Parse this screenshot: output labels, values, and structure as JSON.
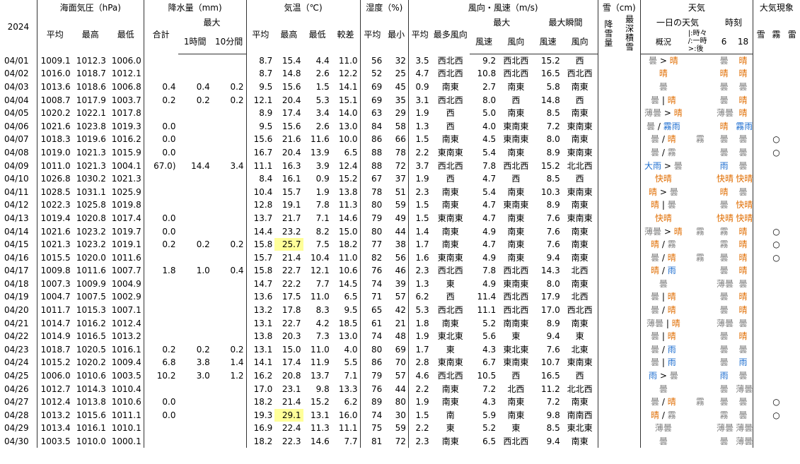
{
  "header": {
    "year": "2024",
    "pressure_group": "海面気圧（hPa)",
    "precip_group": "降水量（mm)",
    "temp_group": "気温（℃)",
    "humidity_group": "湿度（%)",
    "wind_group": "風向・風速（m/s)",
    "snow_group": "雪（cm)",
    "weather_group": "天気",
    "phenomena_group": "大気現象",
    "max": "最大",
    "max_wind": "最大",
    "max_gust": "最大瞬間",
    "day_weather": "一日の天気",
    "times": "時刻",
    "sub": {
      "p_avg": "平均",
      "p_max": "最高",
      "p_min": "最低",
      "r_total": "合計",
      "r_1h": "1時間",
      "r_10m": "10分間",
      "t_avg": "平均",
      "t_max": "最高",
      "t_min": "最低",
      "t_range": "較差",
      "h_avg": "平均",
      "h_min": "最小",
      "w_avg": "平均",
      "w_mostdir": "最多風向",
      "w_spd": "風速",
      "w_dir": "風向",
      "g_spd": "風速",
      "g_dir": "風向",
      "snowfall": "降雪量",
      "snowdepth": "最深積雪",
      "gaikyo": "概況",
      "legend": "|:時々\n/:一時\n>:後",
      "tomonau": "伴う現象",
      "t6": "6",
      "t18": "18",
      "ph_snow": "雪",
      "ph_fog": "霧",
      "ph_thunder": "雷"
    }
  },
  "rows": [
    {
      "date": "04/01",
      "pa": "1009.1",
      "px": "1012.3",
      "pn": "1006.0",
      "rt": "",
      "r1": "",
      "r10": "",
      "ta": "8.7",
      "tx": "15.4",
      "tn": "4.4",
      "tr": "11.0",
      "ha": "56",
      "hn": "32",
      "wa": "3.5",
      "wm": "西北西",
      "ws": "9.2",
      "wd": "西北西",
      "gs": "15.2",
      "gd": "西",
      "w": "曇 > 晴",
      "wp": "",
      "w6": "曇",
      "w18": "晴",
      "fog": ""
    },
    {
      "date": "04/02",
      "pa": "1016.0",
      "px": "1018.7",
      "pn": "1012.1",
      "rt": "",
      "r1": "",
      "r10": "",
      "ta": "8.7",
      "tx": "14.8",
      "tn": "2.6",
      "tr": "12.2",
      "ha": "52",
      "hn": "25",
      "wa": "4.7",
      "wm": "西北西",
      "ws": "10.8",
      "wd": "西北西",
      "gs": "16.5",
      "gd": "西北西",
      "w": "晴",
      "wp": "",
      "w6": "晴",
      "w18": "晴",
      "fog": ""
    },
    {
      "date": "04/03",
      "pa": "1013.6",
      "px": "1018.6",
      "pn": "1006.8",
      "rt": "0.4",
      "r1": "0.4",
      "r10": "0.2",
      "ta": "9.5",
      "tx": "15.6",
      "tn": "1.5",
      "tr": "14.1",
      "ha": "69",
      "hn": "45",
      "wa": "0.9",
      "wm": "南東",
      "ws": "2.7",
      "wd": "南東",
      "gs": "5.8",
      "gd": "南東",
      "w": "曇",
      "wp": "",
      "w6": "曇",
      "w18": "曇",
      "fog": ""
    },
    {
      "date": "04/04",
      "pa": "1008.7",
      "px": "1017.9",
      "pn": "1003.7",
      "rt": "0.2",
      "r1": "0.2",
      "r10": "0.2",
      "ta": "12.1",
      "tx": "20.4",
      "tn": "5.3",
      "tr": "15.1",
      "ha": "69",
      "hn": "35",
      "wa": "3.1",
      "wm": "西北西",
      "ws": "8.0",
      "wd": "西",
      "gs": "14.8",
      "gd": "西",
      "w": "曇 | 晴",
      "wp": "",
      "w6": "曇",
      "w18": "晴",
      "fog": ""
    },
    {
      "date": "04/05",
      "pa": "1020.2",
      "px": "1022.1",
      "pn": "1017.8",
      "rt": "",
      "r1": "",
      "r10": "",
      "ta": "8.9",
      "tx": "17.4",
      "tn": "3.4",
      "tr": "14.0",
      "ha": "63",
      "hn": "29",
      "wa": "1.9",
      "wm": "西",
      "ws": "5.0",
      "wd": "南東",
      "gs": "8.5",
      "gd": "南東",
      "w": "薄曇 > 晴",
      "wp": "",
      "w6": "薄曇",
      "w18": "晴",
      "fog": ""
    },
    {
      "date": "04/06",
      "pa": "1021.6",
      "px": "1023.8",
      "pn": "1019.3",
      "rt": "0.0",
      "r1": "",
      "r10": "",
      "ta": "9.5",
      "tx": "15.6",
      "tn": "2.6",
      "tr": "13.0",
      "ha": "84",
      "hn": "58",
      "wa": "1.3",
      "wm": "西",
      "ws": "4.0",
      "wd": "東南東",
      "gs": "7.2",
      "gd": "東南東",
      "w": "曇 / 霧雨",
      "wp": "",
      "w6": "晴",
      "w18": "霧雨",
      "fog": ""
    },
    {
      "date": "04/07",
      "pa": "1018.3",
      "px": "1019.6",
      "pn": "1016.2",
      "rt": "0.0",
      "r1": "",
      "r10": "",
      "ta": "15.6",
      "tx": "21.6",
      "tn": "11.6",
      "tr": "10.0",
      "ha": "86",
      "hn": "66",
      "wa": "1.5",
      "wm": "南東",
      "ws": "4.5",
      "wd": "東南東",
      "gs": "8.0",
      "gd": "南東",
      "w": "曇 / 晴",
      "wp": "霧",
      "w6": "曇",
      "w18": "曇",
      "fog": "○"
    },
    {
      "date": "04/08",
      "pa": "1019.0",
      "px": "1021.3",
      "pn": "1015.9",
      "rt": "0.0",
      "r1": "",
      "r10": "",
      "ta": "16.7",
      "tx": "20.4",
      "tn": "13.9",
      "tr": "6.5",
      "ha": "88",
      "hn": "78",
      "wa": "2.2",
      "wm": "東南東",
      "ws": "5.4",
      "wd": "南東",
      "gs": "8.9",
      "gd": "東南東",
      "w": "曇 / 霧",
      "wp": "",
      "w6": "曇",
      "w18": "曇",
      "fog": "○"
    },
    {
      "date": "04/09",
      "pa": "1011.0",
      "px": "1021.3",
      "pn": "1004.1",
      "rt": "67.0)",
      "r1": "14.4",
      "r10": "3.4",
      "ta": "11.1",
      "tx": "16.3",
      "tn": "3.9",
      "tr": "12.4",
      "ha": "88",
      "hn": "72",
      "wa": "3.7",
      "wm": "西北西",
      "ws": "7.8",
      "wd": "西北西",
      "gs": "15.2",
      "gd": "北北西",
      "w": "大雨 > 曇",
      "wp": "",
      "w6": "雨",
      "w18": "曇",
      "fog": ""
    },
    {
      "date": "04/10",
      "pa": "1026.8",
      "px": "1030.2",
      "pn": "1021.3",
      "rt": "",
      "r1": "",
      "r10": "",
      "ta": "8.4",
      "tx": "16.1",
      "tn": "0.9",
      "tr": "15.2",
      "ha": "67",
      "hn": "37",
      "wa": "1.9",
      "wm": "西",
      "ws": "4.7",
      "wd": "西",
      "gs": "8.5",
      "gd": "西",
      "w": "快晴",
      "wp": "",
      "w6": "快晴",
      "w18": "快晴",
      "fog": ""
    },
    {
      "date": "04/11",
      "pa": "1028.5",
      "px": "1031.1",
      "pn": "1025.9",
      "rt": "",
      "r1": "",
      "r10": "",
      "ta": "10.4",
      "tx": "15.7",
      "tn": "1.9",
      "tr": "13.8",
      "ha": "78",
      "hn": "51",
      "wa": "2.3",
      "wm": "南東",
      "ws": "5.4",
      "wd": "南東",
      "gs": "10.3",
      "gd": "東南東",
      "w": "晴 > 曇",
      "wp": "",
      "w6": "晴",
      "w18": "曇",
      "fog": ""
    },
    {
      "date": "04/12",
      "pa": "1022.3",
      "px": "1025.8",
      "pn": "1019.8",
      "rt": "",
      "r1": "",
      "r10": "",
      "ta": "12.8",
      "tx": "19.1",
      "tn": "7.8",
      "tr": "11.3",
      "ha": "80",
      "hn": "59",
      "wa": "1.5",
      "wm": "南東",
      "ws": "4.7",
      "wd": "東南東",
      "gs": "8.9",
      "gd": "南東",
      "w": "晴 | 曇",
      "wp": "",
      "w6": "曇",
      "w18": "快晴",
      "fog": ""
    },
    {
      "date": "04/13",
      "pa": "1019.4",
      "px": "1020.8",
      "pn": "1017.4",
      "rt": "0.0",
      "r1": "",
      "r10": "",
      "ta": "13.7",
      "tx": "21.7",
      "tn": "7.1",
      "tr": "14.6",
      "ha": "79",
      "hn": "49",
      "wa": "1.5",
      "wm": "東南東",
      "ws": "4.7",
      "wd": "南東",
      "gs": "7.6",
      "gd": "東南東",
      "w": "快晴",
      "wp": "",
      "w6": "快晴",
      "w18": "快晴",
      "fog": ""
    },
    {
      "date": "04/14",
      "pa": "1021.6",
      "px": "1023.2",
      "pn": "1019.7",
      "rt": "0.0",
      "r1": "",
      "r10": "",
      "ta": "14.4",
      "tx": "23.2",
      "tn": "8.2",
      "tr": "15.0",
      "ha": "80",
      "hn": "44",
      "wa": "1.4",
      "wm": "南東",
      "ws": "4.9",
      "wd": "南東",
      "gs": "7.6",
      "gd": "南東",
      "w": "薄曇 > 晴",
      "wp": "霧",
      "w6": "霧",
      "w18": "晴",
      "fog": "○"
    },
    {
      "date": "04/15",
      "pa": "1021.3",
      "px": "1023.2",
      "pn": "1019.1",
      "rt": "0.2",
      "r1": "0.2",
      "r10": "0.2",
      "ta": "15.8",
      "tx": "25.7",
      "tn": "7.5",
      "tr": "18.2",
      "ha": "77",
      "hn": "38",
      "wa": "1.7",
      "wm": "南東",
      "ws": "4.7",
      "wd": "南東",
      "gs": "7.6",
      "gd": "南東",
      "w": "晴 / 霧",
      "wp": "",
      "w6": "霧",
      "w18": "晴",
      "fog": "○",
      "hlmax": true
    },
    {
      "date": "04/16",
      "pa": "1015.5",
      "px": "1020.0",
      "pn": "1011.6",
      "rt": "",
      "r1": "",
      "r10": "",
      "ta": "15.7",
      "tx": "21.4",
      "tn": "10.4",
      "tr": "11.0",
      "ha": "82",
      "hn": "56",
      "wa": "1.6",
      "wm": "東南東",
      "ws": "4.9",
      "wd": "南東",
      "gs": "9.4",
      "gd": "南東",
      "w": "曇 / 晴",
      "wp": "霧",
      "w6": "曇",
      "w18": "晴",
      "fog": "○"
    },
    {
      "date": "04/17",
      "pa": "1009.8",
      "px": "1011.6",
      "pn": "1007.7",
      "rt": "1.8",
      "r1": "1.0",
      "r10": "0.4",
      "ta": "15.8",
      "tx": "22.7",
      "tn": "12.1",
      "tr": "10.6",
      "ha": "76",
      "hn": "46",
      "wa": "2.3",
      "wm": "西北西",
      "ws": "7.8",
      "wd": "西北西",
      "gs": "14.3",
      "gd": "北西",
      "w": "晴 / 雨",
      "wp": "",
      "w6": "曇",
      "w18": "晴",
      "fog": ""
    },
    {
      "date": "04/18",
      "pa": "1007.3",
      "px": "1009.9",
      "pn": "1004.9",
      "rt": "",
      "r1": "",
      "r10": "",
      "ta": "14.7",
      "tx": "22.2",
      "tn": "7.7",
      "tr": "14.5",
      "ha": "74",
      "hn": "39",
      "wa": "1.3",
      "wm": "東",
      "ws": "4.9",
      "wd": "東南東",
      "gs": "8.0",
      "gd": "南東",
      "w": "曇",
      "wp": "",
      "w6": "薄曇",
      "w18": "曇",
      "fog": ""
    },
    {
      "date": "04/19",
      "pa": "1004.7",
      "px": "1007.5",
      "pn": "1002.9",
      "rt": "",
      "r1": "",
      "r10": "",
      "ta": "13.6",
      "tx": "17.5",
      "tn": "11.0",
      "tr": "6.5",
      "ha": "71",
      "hn": "57",
      "wa": "6.2",
      "wm": "西",
      "ws": "11.4",
      "wd": "西北西",
      "gs": "17.9",
      "gd": "北西",
      "w": "曇 | 晴",
      "wp": "",
      "w6": "曇",
      "w18": "晴",
      "fog": ""
    },
    {
      "date": "04/20",
      "pa": "1011.7",
      "px": "1015.3",
      "pn": "1007.1",
      "rt": "",
      "r1": "",
      "r10": "",
      "ta": "13.2",
      "tx": "17.8",
      "tn": "8.3",
      "tr": "9.5",
      "ha": "65",
      "hn": "42",
      "wa": "5.3",
      "wm": "西北西",
      "ws": "11.1",
      "wd": "西北西",
      "gs": "17.0",
      "gd": "西北西",
      "w": "曇 / 晴",
      "wp": "",
      "w6": "曇",
      "w18": "晴",
      "fog": ""
    },
    {
      "date": "04/21",
      "pa": "1014.7",
      "px": "1016.2",
      "pn": "1012.4",
      "rt": "",
      "r1": "",
      "r10": "",
      "ta": "13.1",
      "tx": "22.7",
      "tn": "4.2",
      "tr": "18.5",
      "ha": "61",
      "hn": "21",
      "wa": "1.8",
      "wm": "南東",
      "ws": "5.2",
      "wd": "南南東",
      "gs": "8.9",
      "gd": "南東",
      "w": "薄曇 | 晴",
      "wp": "",
      "w6": "薄曇",
      "w18": "曇",
      "fog": ""
    },
    {
      "date": "04/22",
      "pa": "1014.9",
      "px": "1016.5",
      "pn": "1013.2",
      "rt": "",
      "r1": "",
      "r10": "",
      "ta": "13.8",
      "tx": "20.3",
      "tn": "7.3",
      "tr": "13.0",
      "ha": "74",
      "hn": "48",
      "wa": "1.9",
      "wm": "東北東",
      "ws": "5.6",
      "wd": "東",
      "gs": "9.4",
      "gd": "東",
      "w": "曇 | 晴",
      "wp": "",
      "w6": "曇",
      "w18": "晴",
      "fog": ""
    },
    {
      "date": "04/23",
      "pa": "1018.7",
      "px": "1020.5",
      "pn": "1016.1",
      "rt": "0.2",
      "r1": "0.2",
      "r10": "0.2",
      "ta": "13.1",
      "tx": "15.0",
      "tn": "11.0",
      "tr": "4.0",
      "ha": "80",
      "hn": "69",
      "wa": "1.7",
      "wm": "東",
      "ws": "4.3",
      "wd": "東北東",
      "gs": "7.6",
      "gd": "北東",
      "w": "曇 / 雨",
      "wp": "",
      "w6": "曇",
      "w18": "曇",
      "fog": ""
    },
    {
      "date": "04/24",
      "pa": "1015.2",
      "px": "1020.2",
      "pn": "1009.4",
      "rt": "6.8",
      "r1": "3.8",
      "r10": "1.4",
      "ta": "14.1",
      "tx": "17.4",
      "tn": "11.9",
      "tr": "5.5",
      "ha": "86",
      "hn": "70",
      "wa": "2.8",
      "wm": "東南東",
      "ws": "6.7",
      "wd": "東南東",
      "gs": "10.7",
      "gd": "東南東",
      "w": "曇 | 雨",
      "wp": "",
      "w6": "曇",
      "w18": "雨",
      "fog": ""
    },
    {
      "date": "04/25",
      "pa": "1006.0",
      "px": "1010.6",
      "pn": "1003.5",
      "rt": "10.2",
      "r1": "3.0",
      "r10": "1.2",
      "ta": "16.2",
      "tx": "20.8",
      "tn": "13.7",
      "tr": "7.1",
      "ha": "79",
      "hn": "57",
      "wa": "4.6",
      "wm": "西北西",
      "ws": "10.5",
      "wd": "西",
      "gs": "16.5",
      "gd": "西",
      "w": "雨 > 曇",
      "wp": "",
      "w6": "雨",
      "w18": "曇",
      "fog": ""
    },
    {
      "date": "04/26",
      "pa": "1012.7",
      "px": "1014.3",
      "pn": "1010.4",
      "rt": "",
      "r1": "",
      "r10": "",
      "ta": "17.0",
      "tx": "23.1",
      "tn": "9.8",
      "tr": "13.3",
      "ha": "76",
      "hn": "44",
      "wa": "2.2",
      "wm": "南東",
      "ws": "7.2",
      "wd": "北西",
      "gs": "11.2",
      "gd": "北北西",
      "w": "曇",
      "wp": "",
      "w6": "曇",
      "w18": "薄曇",
      "fog": ""
    },
    {
      "date": "04/27",
      "pa": "1012.4",
      "px": "1013.8",
      "pn": "1010.6",
      "rt": "0.0",
      "r1": "",
      "r10": "",
      "ta": "18.2",
      "tx": "21.4",
      "tn": "15.2",
      "tr": "6.2",
      "ha": "89",
      "hn": "80",
      "wa": "1.9",
      "wm": "南東",
      "ws": "4.3",
      "wd": "南東",
      "gs": "7.2",
      "gd": "南東",
      "w": "曇 / 晴",
      "wp": "霧",
      "w6": "曇",
      "w18": "曇",
      "fog": "○"
    },
    {
      "date": "04/28",
      "pa": "1013.2",
      "px": "1015.6",
      "pn": "1011.1",
      "rt": "0.0",
      "r1": "",
      "r10": "",
      "ta": "19.3",
      "tx": "29.1",
      "tn": "13.1",
      "tr": "16.0",
      "ha": "74",
      "hn": "30",
      "wa": "1.5",
      "wm": "南",
      "ws": "5.9",
      "wd": "南東",
      "gs": "9.8",
      "gd": "南南西",
      "w": "晴 / 霧",
      "wp": "",
      "w6": "霧",
      "w18": "曇",
      "fog": "○",
      "hlmax": true
    },
    {
      "date": "04/29",
      "pa": "1013.4",
      "px": "1016.1",
      "pn": "1010.1",
      "rt": "",
      "r1": "",
      "r10": "",
      "ta": "16.9",
      "tx": "22.4",
      "tn": "11.3",
      "tr": "11.1",
      "ha": "75",
      "hn": "59",
      "wa": "2.2",
      "wm": "東",
      "ws": "5.2",
      "wd": "東",
      "gs": "8.5",
      "gd": "東北東",
      "w": "薄曇",
      "wp": "",
      "w6": "薄曇",
      "w18": "薄曇",
      "fog": ""
    },
    {
      "date": "04/30",
      "pa": "1003.5",
      "px": "1010.0",
      "pn": "1000.1",
      "rt": "",
      "r1": "",
      "r10": "",
      "ta": "18.2",
      "tx": "22.3",
      "tn": "14.6",
      "tr": "7.7",
      "ha": "81",
      "hn": "72",
      "wa": "2.3",
      "wm": "南東",
      "ws": "6.5",
      "wd": "西北西",
      "gs": "9.4",
      "gd": "南東",
      "w": "曇",
      "wp": "",
      "w6": "曇",
      "w18": "薄曇",
      "fog": ""
    }
  ],
  "colors": {
    "sunny": "#e06d00",
    "cloudy": "#808080",
    "rainy": "#1f6fd0",
    "highlight": "#ffff99"
  }
}
